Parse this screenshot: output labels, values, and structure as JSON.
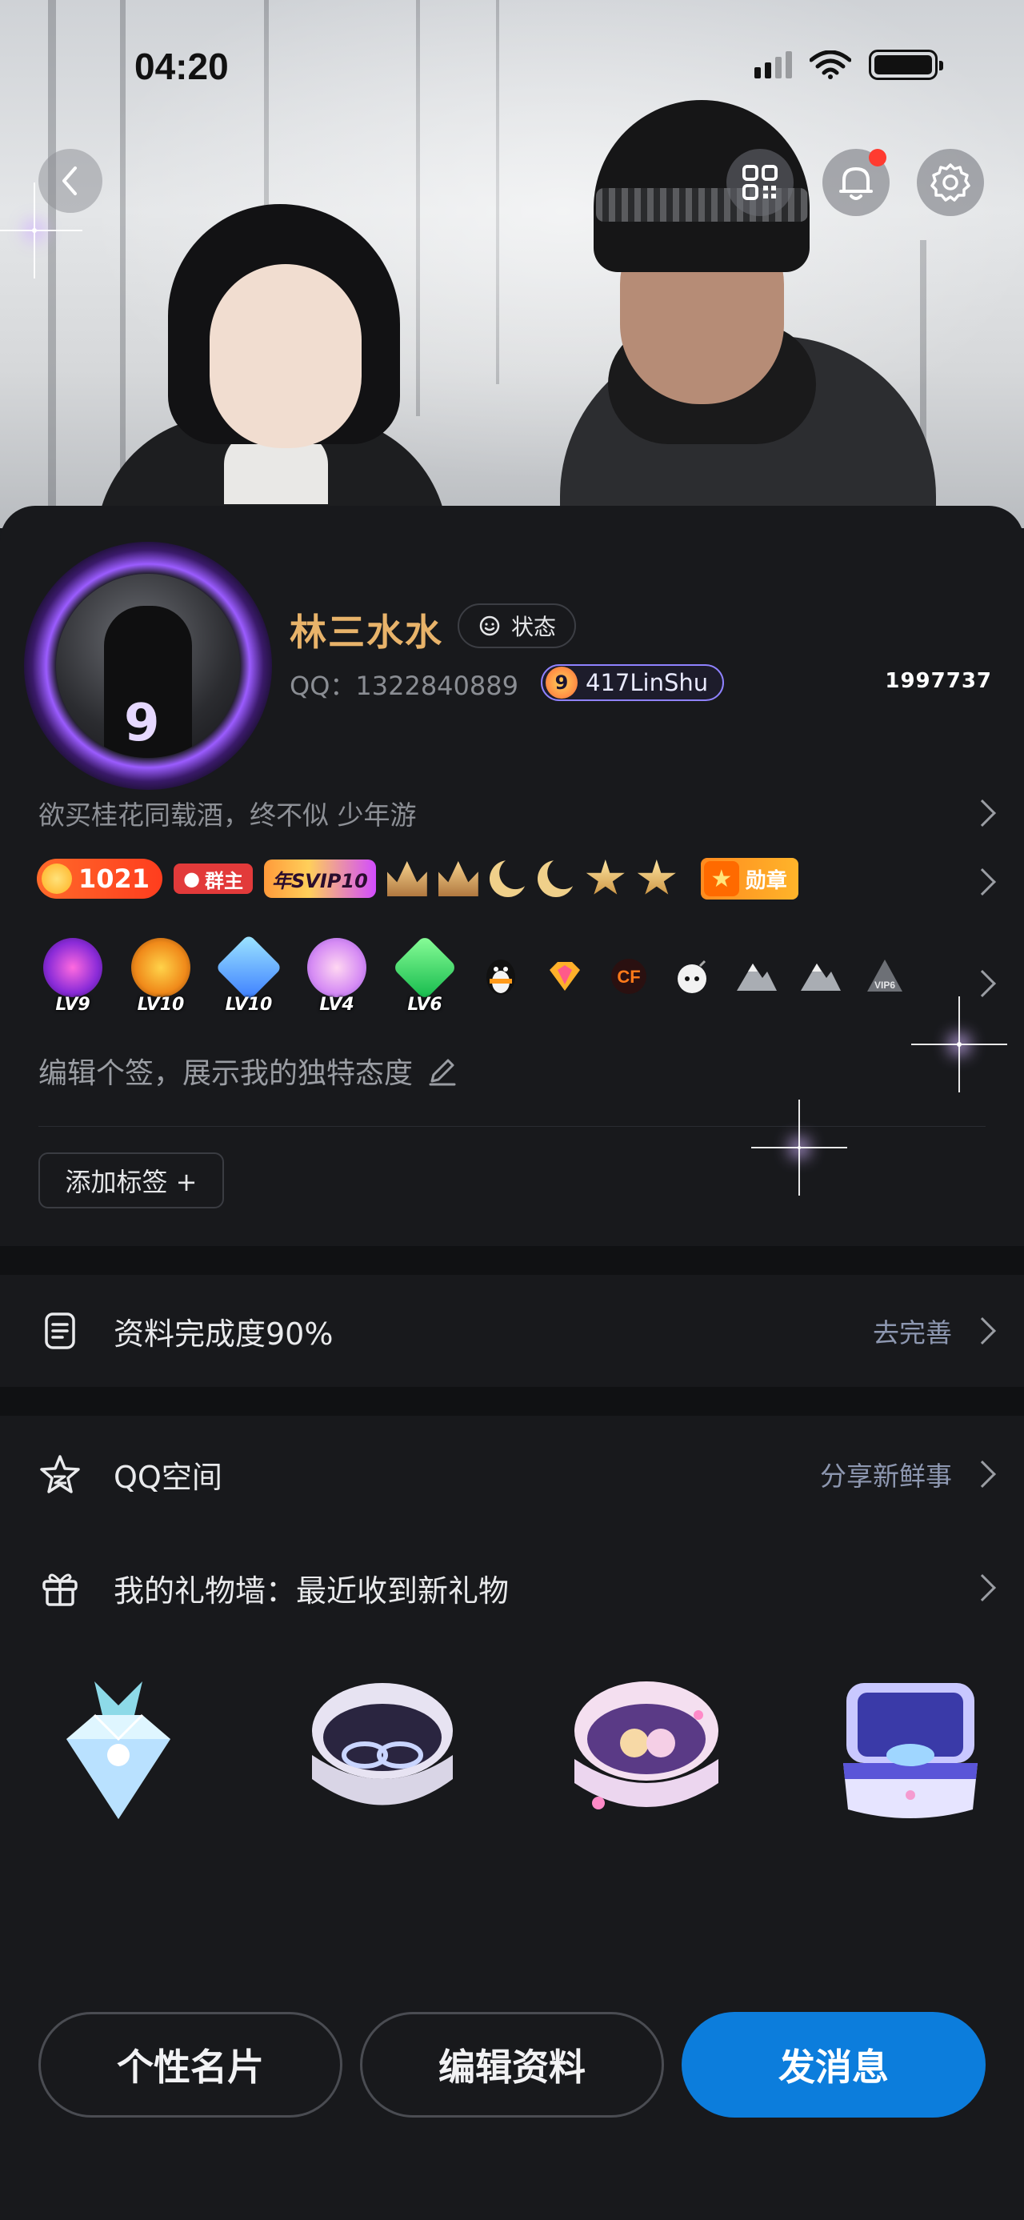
{
  "status_bar": {
    "time": "04:20"
  },
  "header": {
    "back_icon": "chevron-left-icon",
    "actions": [
      "qr-code-icon",
      "bell-icon",
      "gear-icon"
    ],
    "notification_dot_color": "#ff3b30"
  },
  "profile": {
    "name": "林三水水",
    "status_label": "状态",
    "qq_number": "QQ：1322840889",
    "vip_level_digit": "9",
    "vip_name": "417LinShu",
    "count": "1997737",
    "signature_line": "欲买桂花同载酒，终不似  少年游",
    "coin_count": "1021",
    "group_owner_label": "群主",
    "svip_label": "年SVIP10",
    "medal_label": "勋章",
    "level_badges": [
      "LV9",
      "LV10",
      "LV10",
      "LV4",
      "LV6"
    ],
    "edit_signature_placeholder": "编辑个签，展示我的独特态度",
    "add_tag_label": "添加标签 +",
    "name_color": "#e8b36a",
    "accent_color": "#0c7ddc"
  },
  "completion": {
    "label": "资料完成度90%",
    "action": "去完善"
  },
  "qzone": {
    "label": "QQ空间",
    "action": "分享新鲜事"
  },
  "gift_wall": {
    "label": "我的礼物墙：最近收到新礼物",
    "gifts": [
      "diamond-gift-icon",
      "ring-box-gift-icon",
      "teddy-bear-box-gift-icon",
      "dolphin-box-gift-icon"
    ]
  },
  "bottom_actions": {
    "card": "个性名片",
    "edit": "编辑资料",
    "message": "发消息"
  }
}
